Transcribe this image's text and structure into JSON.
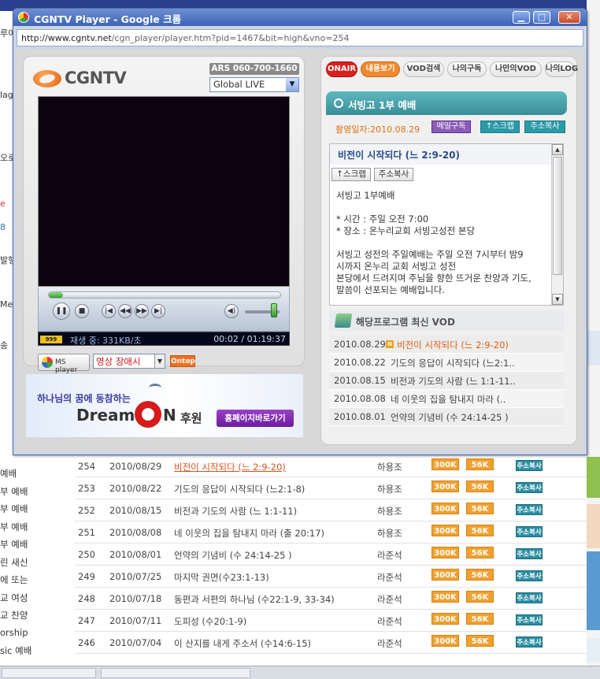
{
  "window": {
    "title": "CGNTV Player - Google 크롬",
    "url_host": "http://www.cgntv.net",
    "url_path": "/cgn_player/player.htm?pid=1467&bit=high&vno=254"
  },
  "player": {
    "logo_text": "CGNTV",
    "ars": "ARS 060-700-1660",
    "channel": "Global LIVE",
    "status_logo": "999",
    "status_text": "재생 중: 331KB/초",
    "time": "00:02 / 01:19:37",
    "progress": 0.06,
    "volume": 0.85,
    "ms_player_label": "MS player",
    "error_option": "영상 장애시",
    "ontop_label": "Ontop"
  },
  "banner": {
    "line1": "하나님의 꿈에 동참하는",
    "brand_left": "Dream-",
    "brand_right": "N",
    "sub": "후원",
    "go": "홈페이지바로가기"
  },
  "tabs": [
    "ONAIR",
    "내용보기",
    "VOD검색",
    "나의구독",
    "나만의VOD",
    "나의LOG"
  ],
  "program": {
    "title": "서빙고 1부 예배",
    "date": "촬영일자:2010.08.29",
    "mail": "메일구독",
    "scrap": "↑스크랩",
    "copy": "주소복사",
    "sermon_title": "비전이 시작되다 (느 2:9-20)",
    "scrap2": "↑스크랩",
    "copy2": "주소복사",
    "desc_lines": [
      "서빙고 1부예배",
      "",
      "* 시간 : 주일 오전 7:00",
      "* 장소 : 온누리교회 서빙고성전 본당",
      "",
      "서빙고 성전의 주일예배는 주일 오전 7시부터 밤9",
      "시까지 온누리 교회 서빙고 성전",
      "본당에서 드려지며 주님을 향한 뜨거운 찬양과 기도,",
      "말씀이 선포되는 예배입니다."
    ]
  },
  "vod": {
    "header": "해당프로그램 최신 VOD",
    "new_badge": "N",
    "items": [
      {
        "date": "2010.08.29",
        "title": "비전이 시작되다 (느 2:9-20)"
      },
      {
        "date": "2010.08.22",
        "title": "기도의 응답이 시작되다 (느2:1.."
      },
      {
        "date": "2010.08.15",
        "title": "비전과 기도의 사람 (느 1:1-11.."
      },
      {
        "date": "2010.08.08",
        "title": "네 이웃의 집을 탐내지 마라 (.."
      },
      {
        "date": "2010.08.01",
        "title": "언약의 기념비 (수 24:14-25 )"
      }
    ]
  },
  "background": {
    "left_fragments": [
      "루이",
      "lag",
      "오로",
      "e",
      "8",
      "발행",
      "Me",
      "송"
    ],
    "left_list": [
      "예배",
      "부 예배",
      "부 예배",
      "부 예배",
      "부 예배",
      "린 새신",
      "에 또는",
      "교 여성",
      "교 찬양",
      "orship",
      "sic 예배"
    ],
    "table_buttons": {
      "hi": "300K",
      "lo": "56K",
      "copy": "주소복사"
    },
    "rows": [
      {
        "no": "254",
        "date": "2010/08/29",
        "title": "비전이 시작되다 (느 2:9-20)",
        "speaker": "하용조"
      },
      {
        "no": "253",
        "date": "2010/08/22",
        "title": "기도의 응답이 시작되다 (느2:1-8)",
        "speaker": "하용조"
      },
      {
        "no": "252",
        "date": "2010/08/15",
        "title": "비전과 기도의 사람 (느 1:1-11)",
        "speaker": "하용조"
      },
      {
        "no": "251",
        "date": "2010/08/08",
        "title": "네 이웃의 집을 탐내지 마라 (출 20:17)",
        "speaker": "하용조"
      },
      {
        "no": "250",
        "date": "2010/08/01",
        "title": "언약의 기념비 (수 24:14-25 )",
        "speaker": "라준석"
      },
      {
        "no": "249",
        "date": "2010/07/25",
        "title": "마지막 권면(수23:1-13)",
        "speaker": "라준석"
      },
      {
        "no": "248",
        "date": "2010/07/18",
        "title": "동편과 서편의 하나님 (수22:1-9, 33-34)",
        "speaker": "라준석"
      },
      {
        "no": "247",
        "date": "2010/07/11",
        "title": "도피성 (수20:1-9)",
        "speaker": "라준석"
      },
      {
        "no": "246",
        "date": "2010/07/04",
        "title": "이 산지를 내게 주소서 (수14:6-15)",
        "speaker": "라준석"
      }
    ]
  }
}
